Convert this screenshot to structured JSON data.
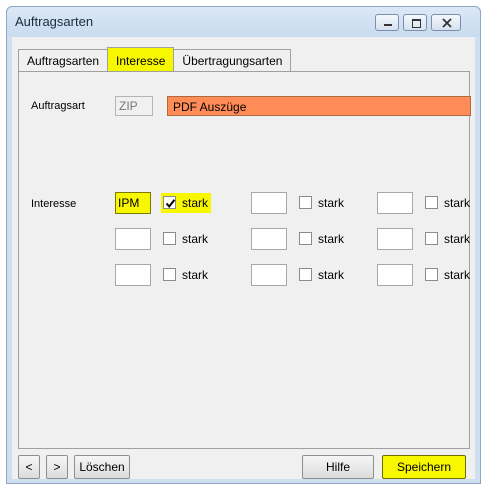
{
  "window": {
    "title": "Auftragsarten"
  },
  "tabs": [
    {
      "label": "Auftragsarten"
    },
    {
      "label": "Interesse",
      "active": true
    },
    {
      "label": "Übertragungsarten"
    }
  ],
  "form": {
    "auftragsart_label": "Auftragsart",
    "auftragsart_code": "ZIP",
    "auftragsart_desc": "PDF Auszüge",
    "interesse_label": "Interesse",
    "stark_label": "stark",
    "interests": [
      {
        "value": "IPM",
        "stark": true
      },
      {
        "value": "",
        "stark": false
      },
      {
        "value": "",
        "stark": false
      },
      {
        "value": "",
        "stark": false
      },
      {
        "value": "",
        "stark": false
      },
      {
        "value": "",
        "stark": false
      },
      {
        "value": "",
        "stark": false
      },
      {
        "value": "",
        "stark": false
      },
      {
        "value": "",
        "stark": false
      }
    ]
  },
  "buttons": {
    "prev": "<",
    "next": ">",
    "delete": "Löschen",
    "help": "Hilfe",
    "save": "Speichern"
  },
  "colors": {
    "highlight": "#f7f700",
    "desc_field": "#ff8c57",
    "window_frame": "#cfdff0"
  }
}
